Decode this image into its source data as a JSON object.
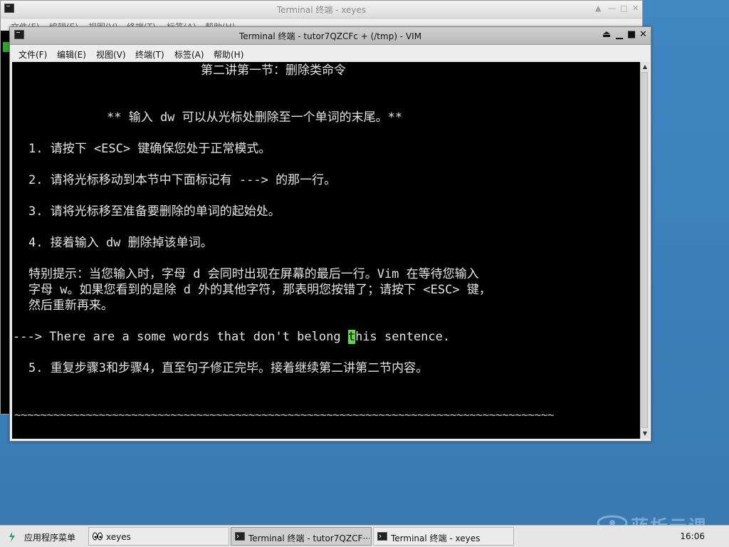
{
  "back_window": {
    "title": "Terminal 终端 - xeyes",
    "menu": [
      "文件(F)",
      "编辑(E)",
      "视图(V)",
      "终端(T)",
      "标签(A)",
      "帮助(H)"
    ],
    "controls": [
      "▲",
      "—",
      "□",
      "✕"
    ]
  },
  "front_window": {
    "title": "Terminal 终端 - tutor7QZCFc + (/tmp) - VIM",
    "menu": [
      "文件(F)",
      "编辑(E)",
      "视图(V)",
      "终端(T)",
      "标签(A)",
      "帮助(H)"
    ],
    "controls": [
      "⏏",
      "▁",
      "■",
      "✕"
    ]
  },
  "terminal": {
    "heading": "第二讲第一节：删除类命令",
    "intro": "** 输入 dw 可以从光标处删除至一个单词的末尾。**",
    "step1": "1. 请按下 <ESC> 键确保您处于正常模式。",
    "step2": "2. 请将光标移动到本节中下面标记有 ---> 的那一行。",
    "step3": "3. 请将光标移至准备要删除的单词的起始处。",
    "step4": "4. 接着输入 dw 删除掉该单词。",
    "tip1": "特别提示：当您输入时，字母 d 会同时出现在屏幕的最后一行。Vim 在等待您输入",
    "tip2": "字母 w。如果您看到的是除 d 外的其他字符，那表明您按错了；请按下 <ESC> 键，",
    "tip3": "然后重新再来。",
    "practice_before": "---> There are a some words that don't belong ",
    "practice_cursor": "t",
    "practice_after": "his sentence.",
    "step5": "5. 重复步骤3和步骤4，直至句子修正完毕。接着继续第二讲第二节内容。",
    "tildes": "~~~~~~~~~~~~~~~~~~~~~~~~~~~~~~~~~~~~~~~~~~~~~~~~~~~~~~~~~~~~~~~~~~~~~~~~~~~~~~~~~~~"
  },
  "colors": {
    "cursor": "#5fd84a",
    "terminal_bg": "#000000",
    "desktop": "#3b7fb8"
  },
  "taskbar": {
    "app_menu": "应用程序菜单",
    "tasks": [
      {
        "label": "xeyes",
        "icon": "eyes-icon"
      },
      {
        "label": "Terminal 终端 - tutor7QZCF···",
        "icon": "terminal-icon",
        "active": true
      },
      {
        "label": "Terminal 终端 - xeyes",
        "icon": "terminal-icon"
      }
    ],
    "clock": "16:06"
  },
  "watermark": "蓝析云课"
}
